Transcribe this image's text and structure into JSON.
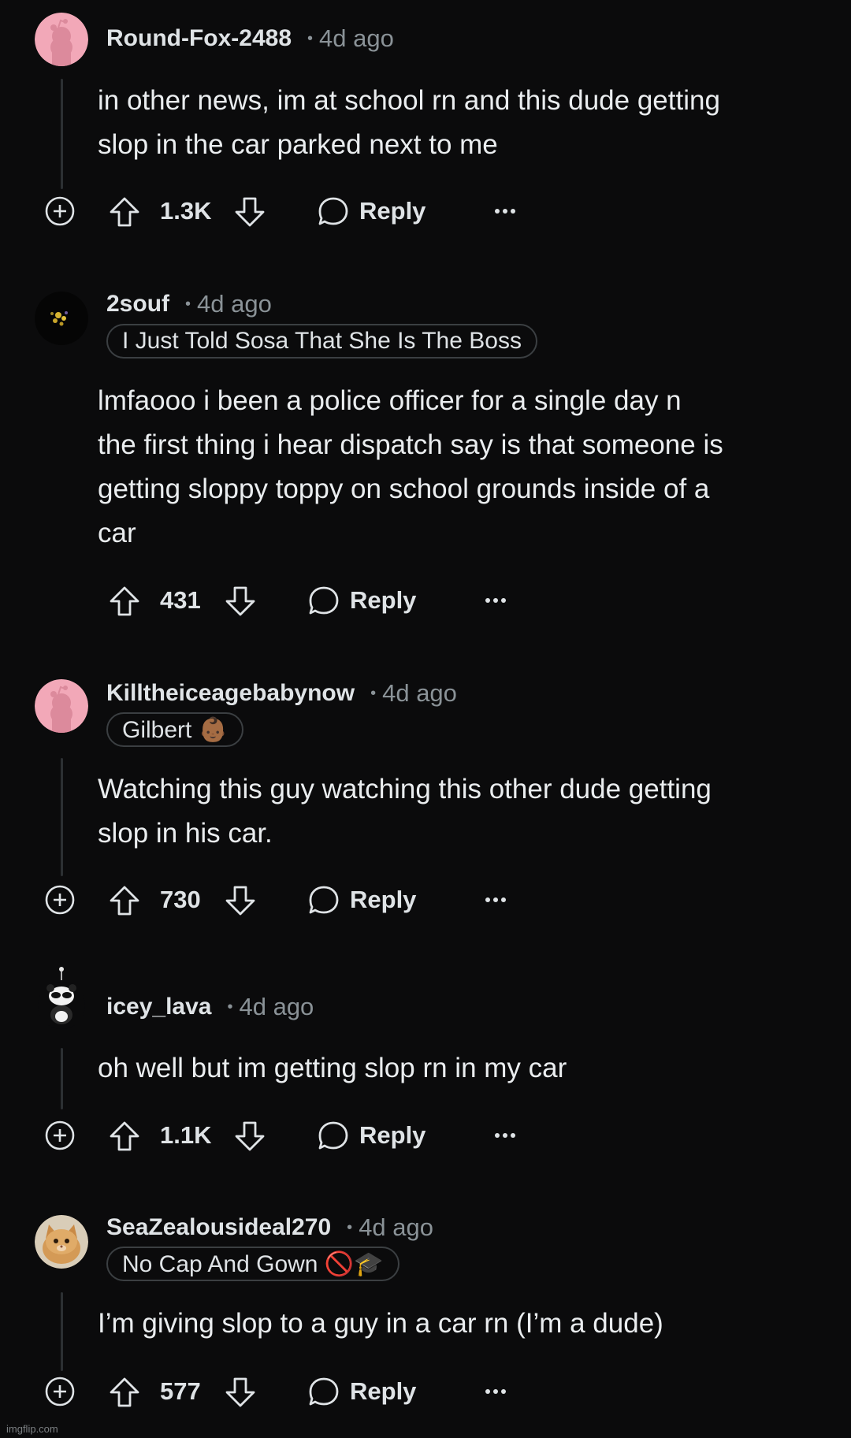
{
  "comments": [
    {
      "username": "Round-Fox-2488",
      "dot": "•",
      "time": "4d ago",
      "flair": null,
      "avatar": "snoo-avatar-pink",
      "body_lines": [
        "in other news, im at school rn and this dude getting",
        "slop in the car parked next to me"
      ],
      "votes": "1.3K",
      "reply": "Reply",
      "has_expand": true
    },
    {
      "username": "2souf",
      "dot": "•",
      "time": "4d ago",
      "flair": "I Just Told Sosa That She Is The Boss",
      "avatar": "dark-flower-avatar",
      "body_lines": [
        "lmfaooo i been a police officer for a single day n",
        "the first thing i hear dispatch say is that someone is",
        "getting sloppy toppy on school grounds inside of a",
        "car"
      ],
      "votes": "431",
      "reply": "Reply",
      "has_expand": false
    },
    {
      "username": "Killtheiceagebabynow",
      "dot": "•",
      "time": "4d ago",
      "flair": "Gilbert 👶🏾",
      "avatar": "snoo-avatar-pink",
      "body_lines": [
        "Watching this guy watching this other dude getting",
        "slop in his car."
      ],
      "votes": "730",
      "reply": "Reply",
      "has_expand": true
    },
    {
      "username": "icey_lava",
      "dot": "•",
      "time": "4d ago",
      "flair": null,
      "avatar": "panda-snoo-avatar",
      "body_lines": [
        "oh well but im getting slop rn in my car"
      ],
      "votes": "1.1K",
      "reply": "Reply",
      "has_expand": true
    },
    {
      "username": "SeaZealousideal270",
      "dot": "•",
      "time": "4d ago",
      "flair": "No Cap And Gown 🚫🎓",
      "avatar": "kitten-avatar",
      "body_lines": [
        "I’m giving slop to a guy in a car rn (I’m a dude)"
      ],
      "votes": "577",
      "reply": "Reply",
      "has_expand": true
    }
  ],
  "icons": {
    "expand": "plus-circle-icon",
    "upvote": "arrow-up-icon",
    "downvote": "arrow-down-icon",
    "reply": "speech-bubble-icon",
    "more": "ellipsis-icon"
  },
  "colors": {
    "background": "#0b0b0c",
    "text": "#eaedef",
    "muted": "#8a9297",
    "snoo_pink": "#f2a8b8"
  },
  "watermark": "imgflip.com"
}
